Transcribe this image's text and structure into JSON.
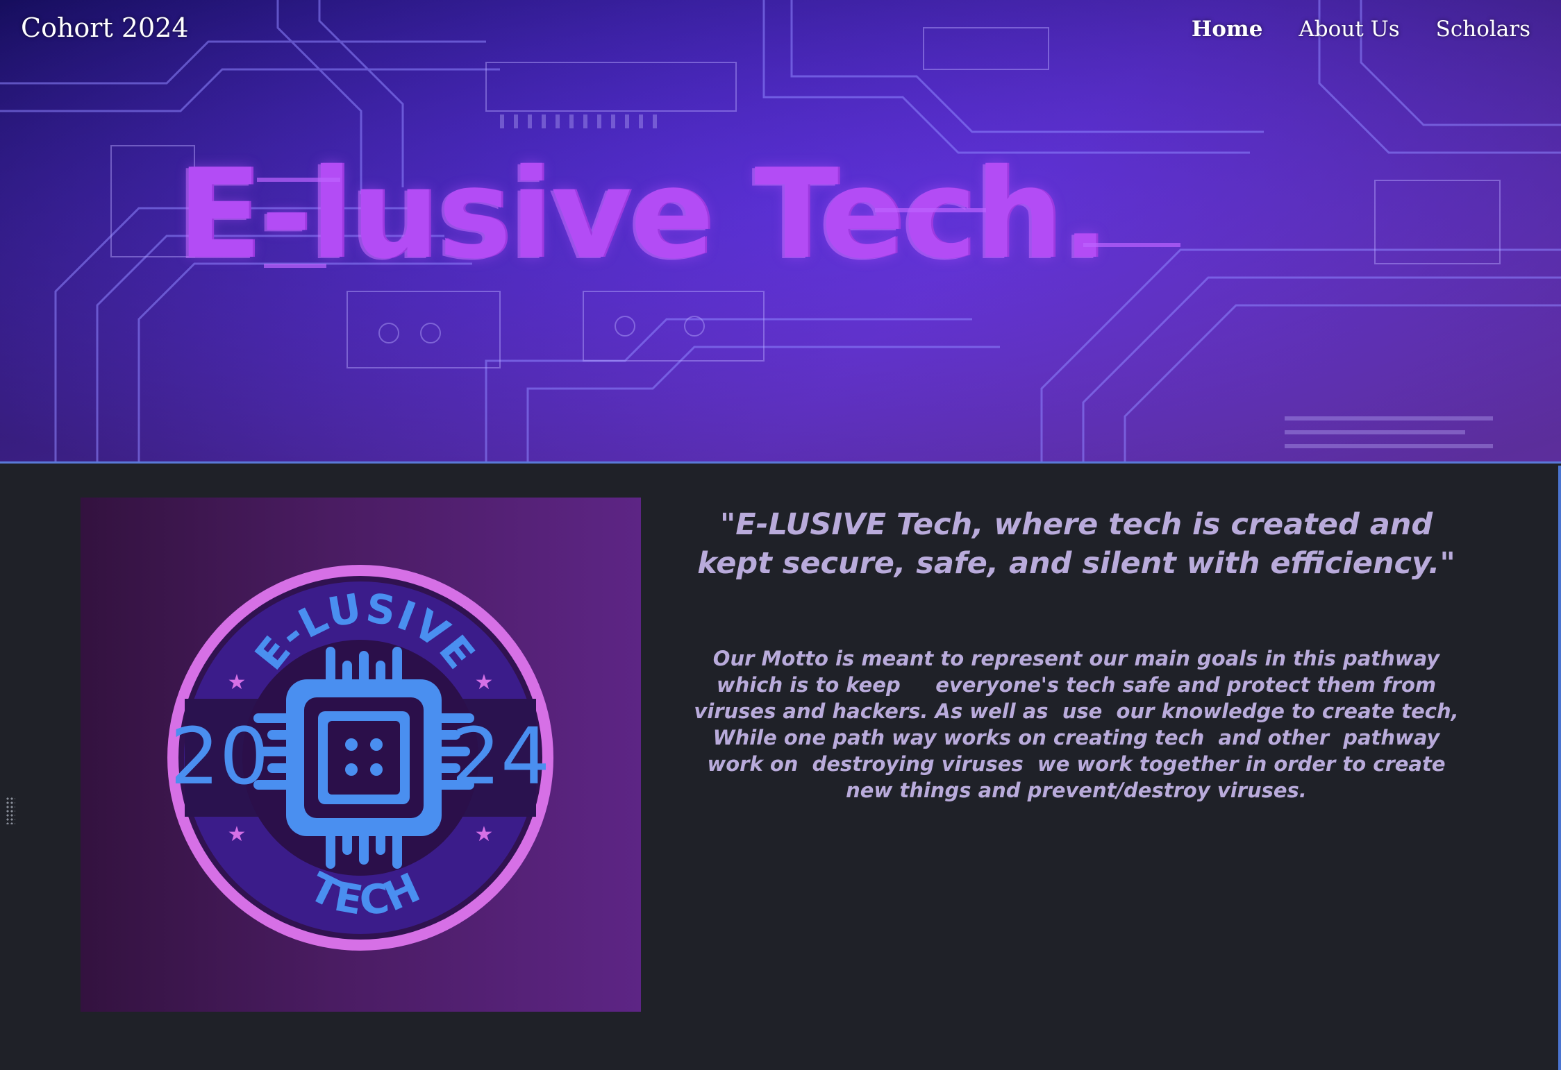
{
  "header": {
    "brand": "Cohort 2024",
    "nav": [
      {
        "label": "Home",
        "active": true
      },
      {
        "label": "About Us",
        "active": false
      },
      {
        "label": "Scholars",
        "active": false
      }
    ]
  },
  "hero": {
    "title": "E-lusive Tech.",
    "background": "purple circuit board image"
  },
  "main": {
    "quote": "\"E-LUSIVE  Tech, where tech is created and kept secure, safe, and silent with efficiency.\"",
    "motto": "Our Motto is meant to represent our main goals in this pathway which is to keep     everyone's tech safe and protect them from viruses and hackers. As well as  use  our knowledge to create tech, While one path way works on creating tech  and other  pathway work on  destroying viruses  we work together in order to create new things and prevent/destroy viruses."
  },
  "logo": {
    "top_text": "E-LUSIVE",
    "year_left": "20",
    "year_right": "24",
    "bottom_text": "TECH",
    "icon": "microchip-icon"
  },
  "colors": {
    "page_bg": "#1f2128",
    "title_purple": "#b34cf5",
    "text_lavender": "#b9abdb",
    "logo_ring": "#d670e6",
    "logo_blue": "#4a8ff0"
  }
}
